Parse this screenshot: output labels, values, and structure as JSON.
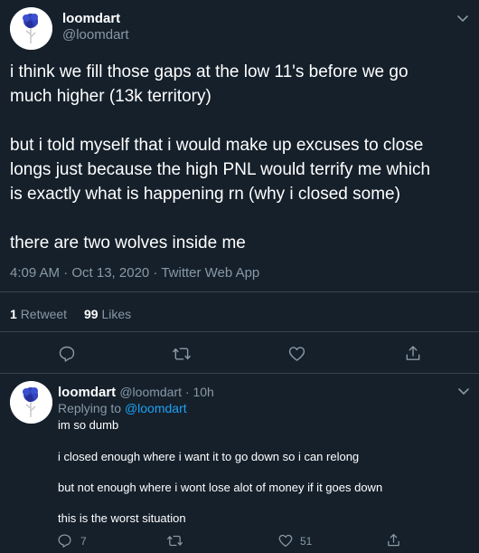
{
  "main": {
    "display_name": "loomdart",
    "handle": "@loomdart",
    "text_lines": [
      "i think we fill those gaps at the low 11's before we go",
      "much higher (13k territory)",
      "but i told myself that i would make up excuses to close",
      "longs just because the high PNL would terrify me which",
      "is exactly what is happening rn (why i closed some)",
      "there are two wolves inside me"
    ],
    "timestamp": "4:09 AM · Oct 13, 2020 · Twitter Web App",
    "retweets_count": "1",
    "retweets_label": "Retweet",
    "likes_count": "99",
    "likes_label": "Likes"
  },
  "reply": {
    "display_name": "loomdart",
    "handle_time": "@loomdart · 10h",
    "replying_prefix": "Replying to",
    "replying_to": "@loomdart",
    "text_lines": [
      "im so dumb",
      "i closed enough where i want it to go down so i can relong",
      "but not enough where i wont lose alot of money if it goes down",
      "this is the worst situation"
    ],
    "reply_count": "7",
    "like_count": "51"
  },
  "icons": {
    "reply": "reply-icon",
    "retweet": "retweet-icon",
    "like": "heart-icon",
    "share": "share-icon",
    "more": "chevron-down-icon"
  },
  "colors": {
    "background": "#15202b",
    "divider": "#38444d",
    "secondary_text": "#8899a6",
    "link": "#1da1f2"
  }
}
